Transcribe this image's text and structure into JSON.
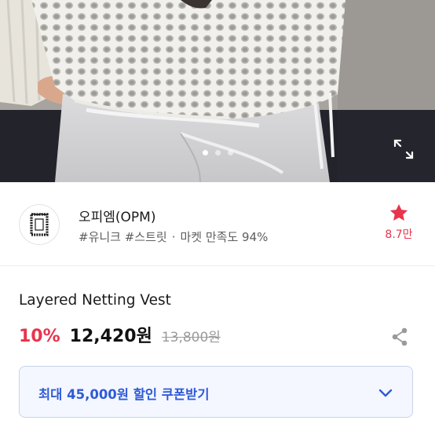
{
  "carousel": {
    "slide_count": 3,
    "active_index": 0
  },
  "icons": {
    "expand": "expand-icon",
    "favorite": "star-icon",
    "share": "share-icon",
    "coupon_toggle": "chevron-down-icon"
  },
  "shop": {
    "name": "오피엠(OPM)",
    "tags": "#유니크 #스트릿",
    "separator": "·",
    "satisfaction": "마켓 만족도 94%",
    "favorite_count": "8.7만"
  },
  "product": {
    "title": "Layered Netting Vest",
    "discount": "10%",
    "price": "12,420원",
    "original_price": "13,800원"
  },
  "coupon": {
    "label": "최대 45,000원 할인 쿠폰받기"
  },
  "colors": {
    "accent_red": "#e8344d",
    "coupon_blue": "#2f5bd8",
    "coupon_bg": "#f4f7ff",
    "coupon_border": "#c9d3ea"
  }
}
